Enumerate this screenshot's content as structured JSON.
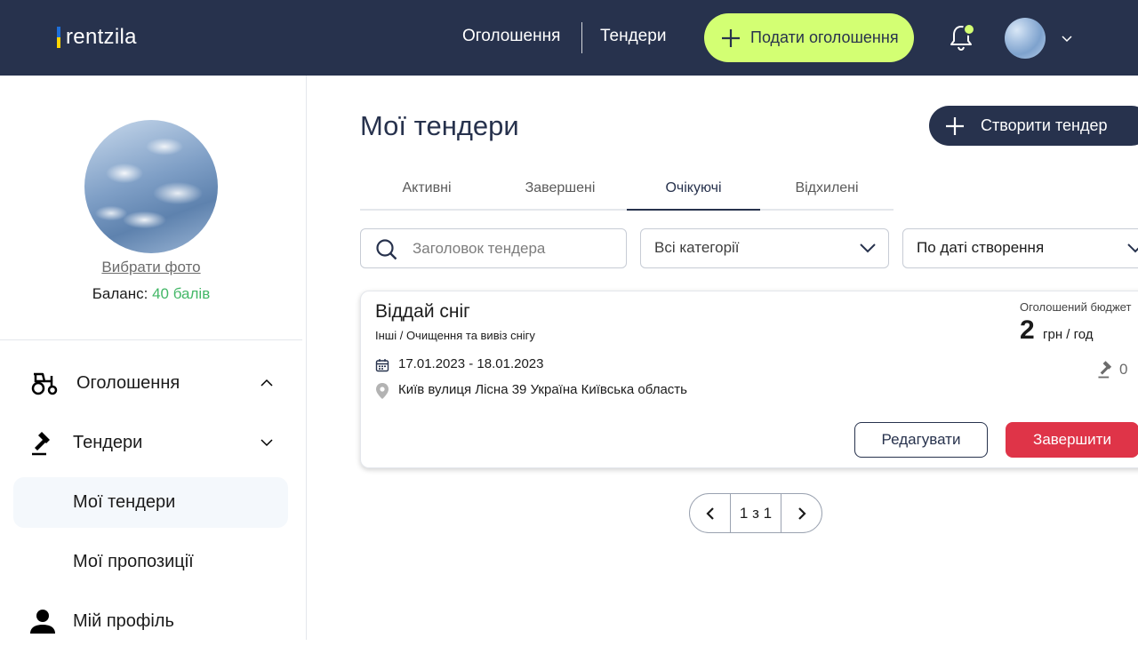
{
  "header": {
    "logo_text": "rentzila",
    "nav": [
      "Оголошення",
      "Тендери"
    ],
    "post_button": "Подати оголошення"
  },
  "sidebar": {
    "choose_photo": "Вибрати фото",
    "balance_label": "Баланс:",
    "balance_value": "40 балів",
    "menu": {
      "ads": "Оголошення",
      "tenders": "Тендери",
      "my_tenders": "Мої тендери",
      "my_proposals": "Мої пропозиції",
      "profile": "Мій профіль"
    }
  },
  "main": {
    "title": "Мої тендери",
    "create_button": "Створити тендер",
    "tabs": [
      "Активні",
      "Завершені",
      "Очікуючі",
      "Відхилені"
    ],
    "active_tab": "Очікуючі",
    "search_placeholder": "Заголовок тендера",
    "category_select": "Всі категорії",
    "sort_select": "По даті створення",
    "tender": {
      "title": "Віддай сніг",
      "category": "Інші / Очищення та вивіз снігу",
      "dates": "17.01.2023 - 18.01.2023",
      "location": "Київ вулиця Лісна 39 Україна Київська область",
      "budget_label": "Оголошений бюджет",
      "budget_amount": "2",
      "budget_unit": "грн / год",
      "bids": "0",
      "edit_button": "Редагувати",
      "finish_button": "Завершити"
    },
    "pagination": "1 з 1"
  },
  "colors": {
    "header_bg": "#27324d",
    "accent_green": "#d3ff73",
    "balance_green": "#43b767",
    "danger": "#df3448"
  }
}
